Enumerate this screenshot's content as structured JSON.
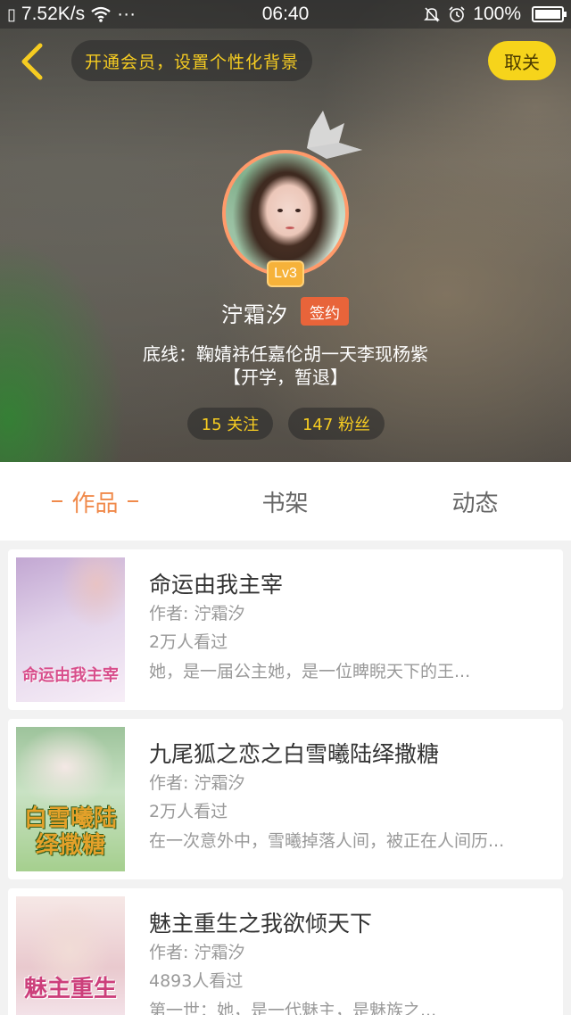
{
  "status_bar": {
    "speed": "7.52K/s",
    "dots": "···",
    "time": "06:40",
    "battery": "100%"
  },
  "header": {
    "vip_promo": "开通会员，设置个性化背景",
    "unfollow_label": "取关"
  },
  "profile": {
    "level": "Lv3",
    "name": "泞霜汐",
    "signed_badge": "签约",
    "bio_line1": "底线：鞠婧祎任嘉伦胡一天李现杨紫",
    "bio_line2": "【开学，暂退】",
    "following": "15 关注",
    "fans": "147 粉丝"
  },
  "tabs": [
    {
      "label": "作品",
      "active": true
    },
    {
      "label": "书架",
      "active": false
    },
    {
      "label": "动态",
      "active": false
    }
  ],
  "books": [
    {
      "title": "命运由我主宰",
      "author": "作者: 泞霜汐",
      "views": "2万人看过",
      "desc": "她，是一届公主她，是一位睥睨天下的王...",
      "cover_text": "命运由我主宰"
    },
    {
      "title": "九尾狐之恋之白雪曦陆绎撒糖",
      "author": "作者: 泞霜汐",
      "views": "2万人看过",
      "desc": "在一次意外中，雪曦掉落人间，被正在人间历...",
      "cover_text": "白雪曦陆绎撒糖"
    },
    {
      "title": "魅主重生之我欲倾天下",
      "author": "作者: 泞霜汐",
      "views": "4893人看过",
      "desc": "第一世：她，是一代魅主，是魅族之...",
      "cover_text": "魅主重生"
    }
  ],
  "colors": {
    "accent": "#f08a4b",
    "gold": "#f6cc21",
    "unfollow_bg": "#f6d41b",
    "signed_bg": "#e8643a",
    "level_bg": "#f6b23a"
  }
}
